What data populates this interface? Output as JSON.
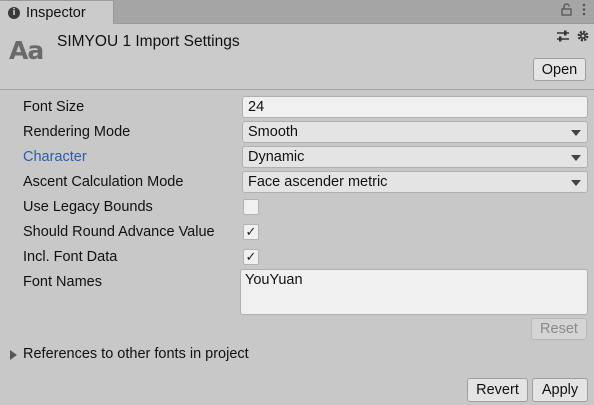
{
  "tab": {
    "icon": "info-icon",
    "label": "Inspector"
  },
  "tab_actions": {
    "lock_icon": "lock-icon",
    "menu_icon": "kebab-menu-icon"
  },
  "header": {
    "icon": "font-asset-icon",
    "icon_text": "Aa",
    "title": "SIMYOU 1 Import Settings",
    "presets_icon": "sliders-icon",
    "settings_icon": "gear-icon",
    "open_label": "Open"
  },
  "fields": {
    "font_size": {
      "label": "Font Size",
      "value": "24"
    },
    "rendering_mode": {
      "label": "Rendering Mode",
      "value": "Smooth"
    },
    "character": {
      "label": "Character",
      "value": "Dynamic"
    },
    "ascent_mode": {
      "label": "Ascent Calculation Mode",
      "value": "Face ascender metric"
    },
    "legacy_bounds": {
      "label": "Use Legacy Bounds",
      "checked": false
    },
    "round_advance": {
      "label": "Should Round Advance Value",
      "checked": true,
      "mark": "✓"
    },
    "incl_font_data": {
      "label": "Incl. Font Data",
      "checked": true,
      "mark": "✓"
    },
    "font_names": {
      "label": "Font Names",
      "value": "YouYuan"
    }
  },
  "reset_label": "Reset",
  "foldout": {
    "label": "References to other fonts in project"
  },
  "footer": {
    "revert_label": "Revert",
    "apply_label": "Apply"
  },
  "colors": {
    "link": "#2a5db0",
    "panel": "#c8c8c8",
    "field": "#f0f0f0"
  }
}
